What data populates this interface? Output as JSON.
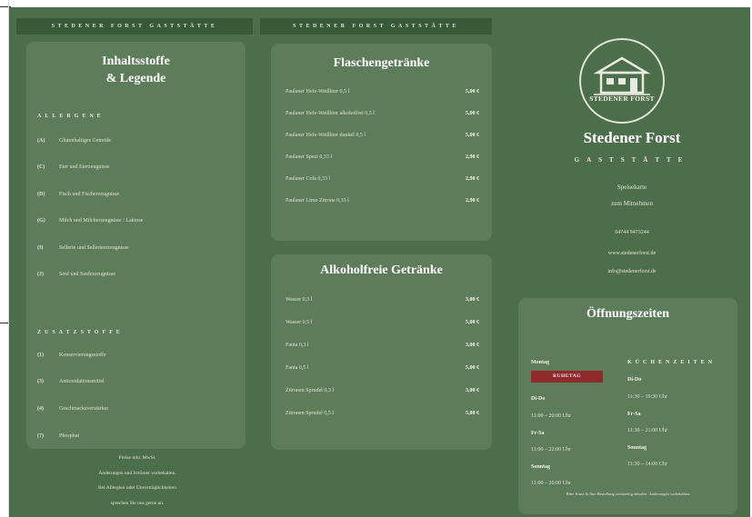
{
  "header_text": "STEDENER FORST GASTSTÄTTE",
  "legend": {
    "title_line1": "Inhaltsstoffe",
    "title_line2": "& Legende",
    "allergens_heading": "ALLERGENE",
    "allergens": [
      {
        "code": "(A)",
        "label": "Glutenhaltiges Getreide"
      },
      {
        "code": "(C)",
        "label": "Eier und Eierzeugnisse"
      },
      {
        "code": "(D)",
        "label": "Fisch und Fischerzeugnisse"
      },
      {
        "code": "(G)",
        "label": "Milch und Milcherzeugnisse / Laktose"
      },
      {
        "code": "(I)",
        "label": "Sellerie und Sellerieerzeugnisse"
      },
      {
        "code": "(J)",
        "label": "Senf und Senferzeugnisse"
      }
    ],
    "additives_heading": "ZUSATZSTOFFE",
    "additives": [
      {
        "code": "(1)",
        "label": "Konservierungsstoffe"
      },
      {
        "code": "(3)",
        "label": "Antioxidationsmittel"
      },
      {
        "code": "(4)",
        "label": "Geschmacksverstärker"
      },
      {
        "code": "(7)",
        "label": "Phosphat"
      }
    ]
  },
  "footer_note": {
    "line1": "Preise inkl. MwSt.",
    "line2": "Änderungen und Irrtümer vorbehalten.",
    "line3": "Bei Allergien oder Unverträglichkeiten",
    "line4": "sprechen Sie uns gerne an."
  },
  "bottled_drinks": {
    "title": "Flaschengetränke",
    "items": [
      {
        "name": "Paulaner Hefe-Weißbier 0,5 l",
        "price": "5,00 €"
      },
      {
        "name": "Paulaner Hefe-Weißbier alkoholfrei 0,5 l",
        "price": "5,00 €"
      },
      {
        "name": "Paulaner Hefe-Weißbier dunkel 0,5 l",
        "price": "5,00 €"
      },
      {
        "name": "Paulaner Spezi 0,33 l",
        "price": "2,90 €"
      },
      {
        "name": "Paulaner Cola 0,33 l",
        "price": "2,90 €"
      },
      {
        "name": "Paulaner Limo Zitrone 0,33 l",
        "price": "2,90 €"
      }
    ]
  },
  "soft_drinks": {
    "title": "Alkoholfreie Getränke",
    "items": [
      {
        "name": "Wasser 0,3 l",
        "price": "3,00 €"
      },
      {
        "name": "Wasser 0,5 l",
        "price": "5,00 €"
      },
      {
        "name": "Fanta 0,3 l",
        "price": "3,00 €"
      },
      {
        "name": "Fanta 0,5 l",
        "price": "5,00 €"
      },
      {
        "name": "Zitronen Sprudel 0,3 l",
        "price": "3,00 €"
      },
      {
        "name": "Zitronen Sprudel 0,5 l",
        "price": "5,00 €"
      }
    ]
  },
  "brand": {
    "logo_text": "STEDENER FORST",
    "name": "Stedener Forst",
    "subtitle": "GASTSTÄTTE",
    "tagline1": "Speisekarte",
    "tagline2": "zum Mitnehmen",
    "phone": "04744 9473244",
    "website": "www.stedenerforst.de",
    "email": "info@stedenerforst.de"
  },
  "opening_hours": {
    "title": "Öffnungszeiten",
    "left": [
      {
        "day": "Montag",
        "time": ""
      },
      {
        "day": "Di-Do",
        "time": "11:00 – 20:00 Uhr"
      },
      {
        "day": "Fr-Sa",
        "time": "11:00 – 22:00 Uhr"
      },
      {
        "day": "Sonntag",
        "time": "11:00 – 20:00 Uhr"
      }
    ],
    "ruhetag": "RUHETAG",
    "kitchen_heading": "KÜCHENZEITEN",
    "right": [
      {
        "day": "Di-Do",
        "time": "11:30 – 19:30 Uhr"
      },
      {
        "day": "Fr-Sa",
        "time": "11:30 – 21:00 Uhr"
      },
      {
        "day": "Sonntag",
        "time": "11:30 – 14:00 Uhr"
      }
    ],
    "footer": "Bitte Karte & Ihre Bestellung rechtzeitig abholen. Änderungen vorbehalten."
  },
  "colors": {
    "background": "#4d6e4a",
    "panel": "#5d7c59",
    "header_bar": "#385a36",
    "ruhetag_badge": "#8f2a2a"
  }
}
